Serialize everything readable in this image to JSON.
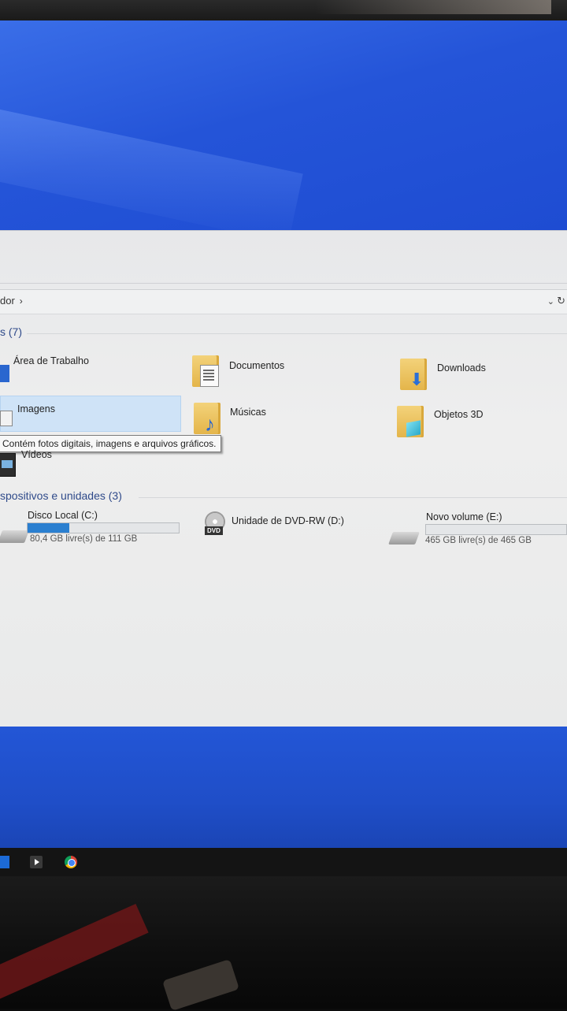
{
  "address_bar": {
    "crumb": "dor",
    "separator": "›",
    "dropdown": "⌄",
    "refresh": "↻"
  },
  "folders_section": {
    "title": "s (7)"
  },
  "folders": [
    {
      "label": "Área de Trabalho",
      "icon": "desktop-icon"
    },
    {
      "label": "Documentos",
      "icon": "documents-folder-icon"
    },
    {
      "label": "Downloads",
      "icon": "downloads-folder-icon"
    },
    {
      "label": "Imagens",
      "icon": "pictures-icon"
    },
    {
      "label": "Músicas",
      "icon": "music-folder-icon"
    },
    {
      "label": "Objetos 3D",
      "icon": "3d-objects-folder-icon"
    },
    {
      "label": "Vídeos",
      "icon": "videos-icon"
    }
  ],
  "tooltip": {
    "text": "Contém fotos digitais, imagens e arquivos gráficos."
  },
  "devices_section": {
    "title": "spositivos e unidades (3)"
  },
  "drives": [
    {
      "label": "Disco Local (C:)",
      "free_text": "80,4 GB livre(s) de 111 GB",
      "used_fraction": 0.276,
      "icon": "hard-drive-icon"
    },
    {
      "label": "Unidade de DVD-RW (D:)",
      "icon": "dvd-drive-icon",
      "badge": "DVD"
    },
    {
      "label": "Novo volume (E:)",
      "free_text": "465 GB livre(s) de 465 GB",
      "used_fraction": 0.0,
      "icon": "hard-drive-icon"
    }
  ],
  "colors": {
    "desktop_blue": "#2454d8",
    "selection": "#cfe3f7",
    "progress": "#2a7fd0",
    "section_title": "#2f4a8a"
  }
}
